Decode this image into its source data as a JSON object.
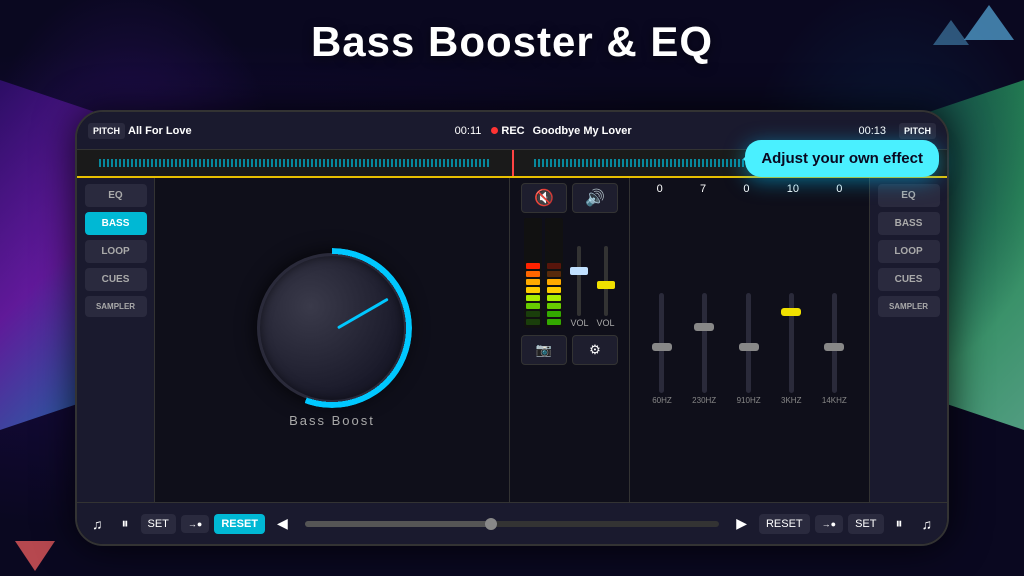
{
  "page": {
    "title": "Bass Booster & EQ",
    "bg_color": "#0a0820"
  },
  "tooltip": {
    "text": "Adjust your own effect"
  },
  "top_bar": {
    "left_track": "All For Love",
    "left_time": "00:11",
    "rec_label": "REC",
    "right_track": "Goodbye My Lover",
    "right_time": "00:13",
    "pitch_label": "PITCH"
  },
  "left_panel": {
    "buttons": [
      {
        "label": "EQ",
        "active": false
      },
      {
        "label": "BASS",
        "active": true
      },
      {
        "label": "LOOP",
        "active": false
      },
      {
        "label": "CUES",
        "active": false
      },
      {
        "label": "SAMPLER",
        "active": false
      }
    ]
  },
  "right_panel": {
    "buttons": [
      {
        "label": "EQ",
        "active": false
      },
      {
        "label": "BASS",
        "active": false
      },
      {
        "label": "LOOP",
        "active": false
      },
      {
        "label": "CUES",
        "active": false
      },
      {
        "label": "SAMPLER",
        "active": false
      }
    ]
  },
  "knob": {
    "label": "Bass Boost"
  },
  "mixer": {
    "btn1": "🔈",
    "btn2": "🔊",
    "vol_label": "VOL",
    "vol_label2": "VOL",
    "icon1": "📷",
    "icon2": "⚙"
  },
  "eq": {
    "values": [
      "0",
      "7",
      "0",
      "10",
      "0"
    ],
    "freq_labels": [
      "60HZ",
      "230HZ",
      "910HZ",
      "3KHZ",
      "14KHZ"
    ],
    "fader_positions": [
      50,
      30,
      50,
      15,
      50
    ]
  },
  "transport": {
    "btn_music": "♫",
    "btn_pause": "⏸",
    "btn_set": "SET",
    "btn_arrow_rec": "→●",
    "btn_reset": "RESET",
    "btn_prev": "◀",
    "btn_next": "▶",
    "btn_reset2": "RESET",
    "btn_arrow_rec2": "→●",
    "btn_set2": "SET",
    "btn_pause2": "⏸",
    "btn_music2": "♫"
  }
}
